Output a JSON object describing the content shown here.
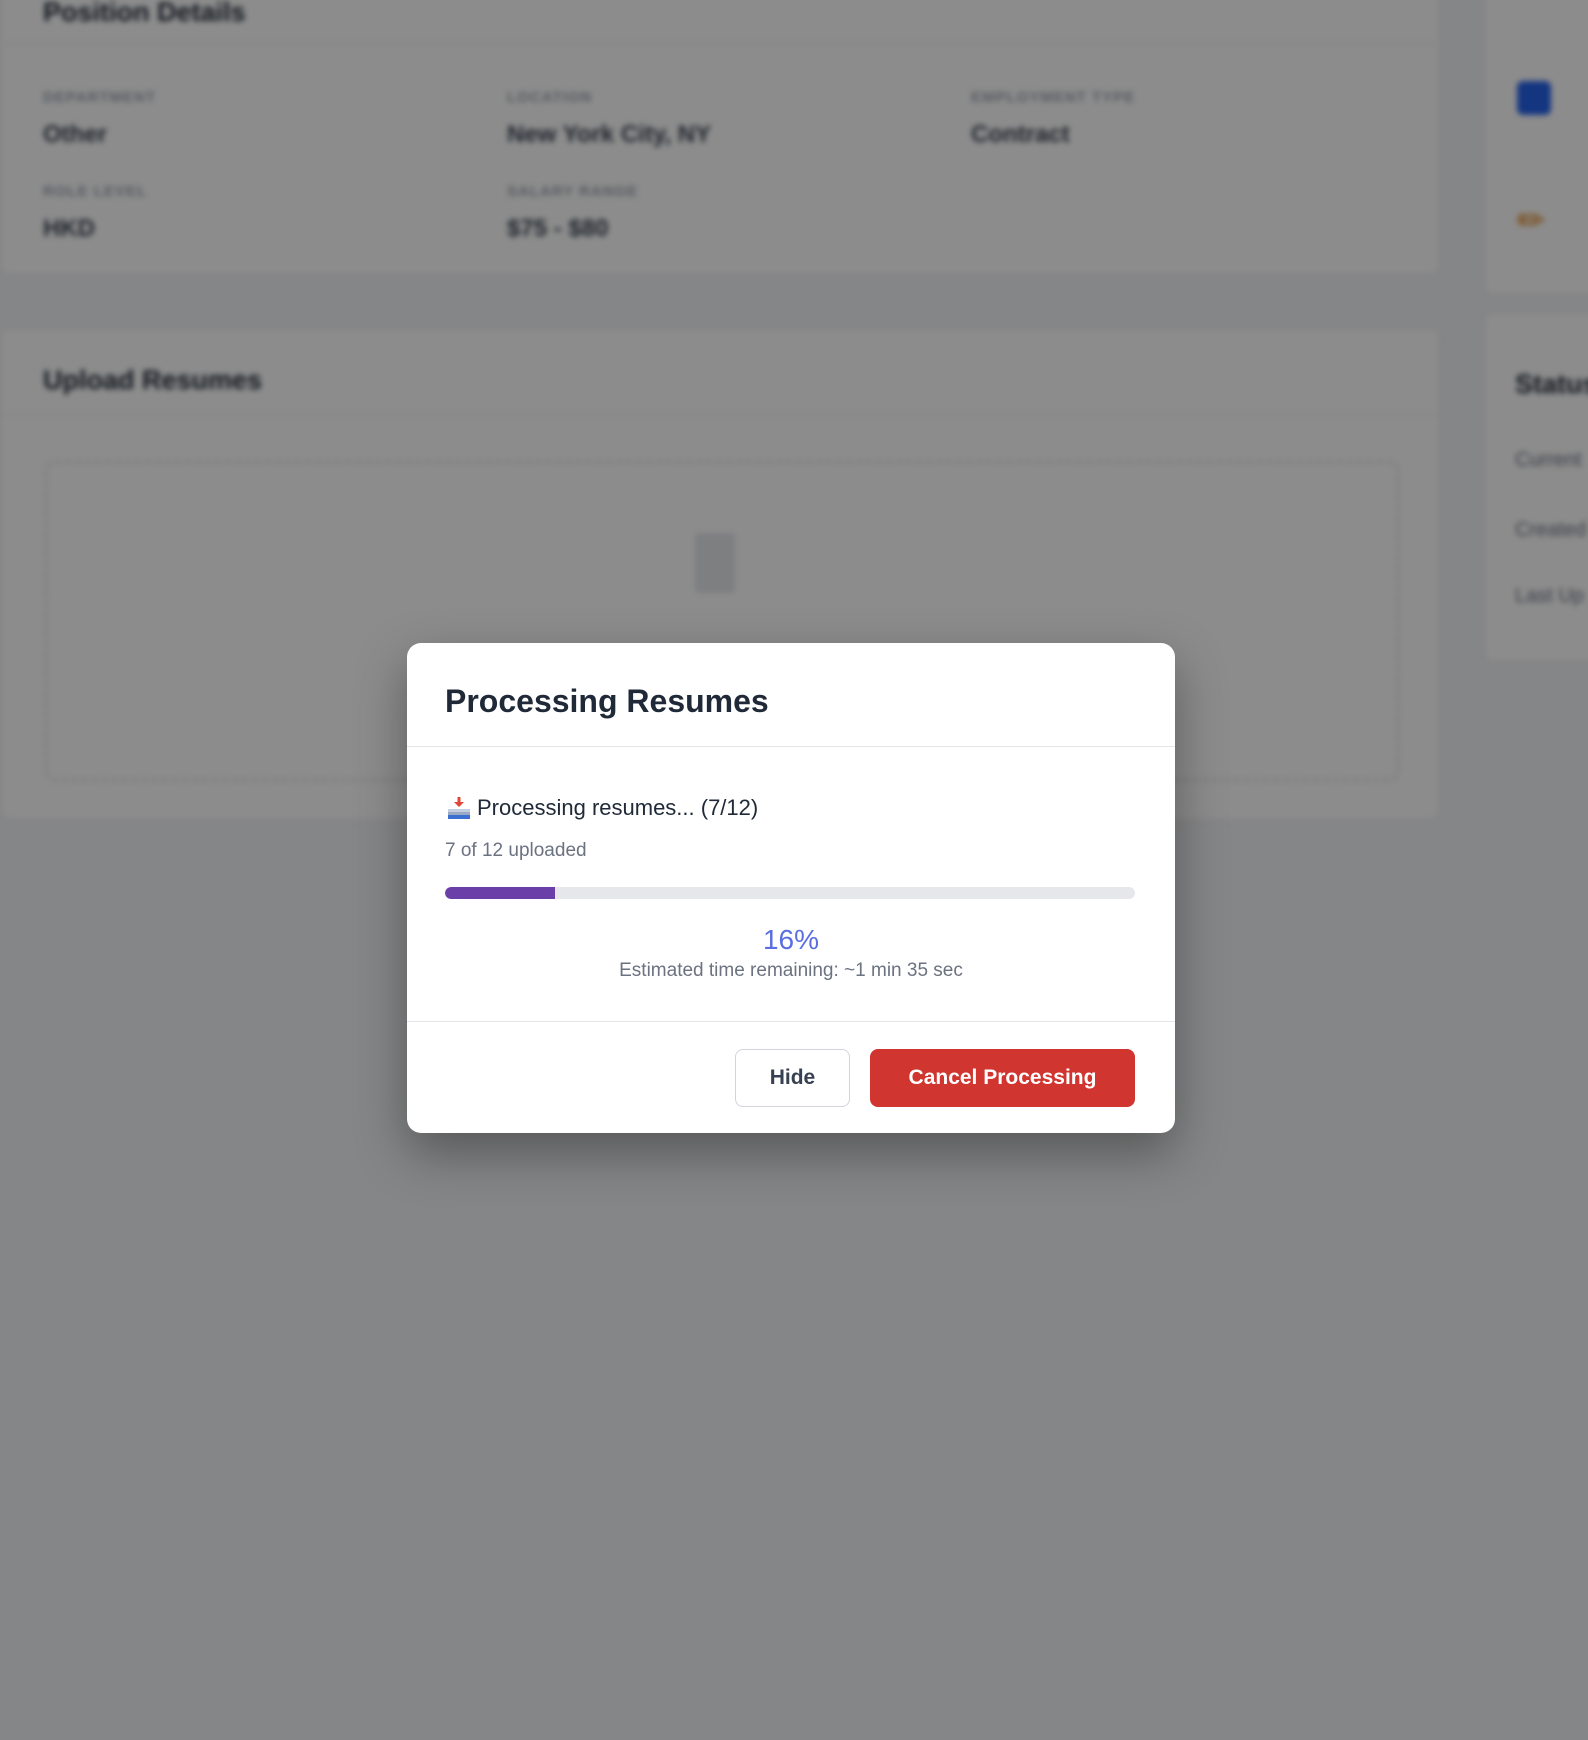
{
  "background": {
    "position_card": {
      "title": "Position Details",
      "fields": [
        {
          "label": "Department",
          "value": "Other"
        },
        {
          "label": "Location",
          "value": "New York City, NY"
        },
        {
          "label": "Employment Type",
          "value": "Contract"
        },
        {
          "label": "Role Level",
          "value": "HKD"
        },
        {
          "label": "Salary Range",
          "value": "$75 - $80"
        }
      ]
    },
    "upload_card": {
      "title": "Upload Resumes"
    },
    "status_card": {
      "title": "Status",
      "lines": [
        "Current",
        "Created",
        "Last Up"
      ]
    }
  },
  "modal": {
    "title": "Processing Resumes",
    "status_text": "Processing resumes... (7/12)",
    "uploaded_text": "7 of 12 uploaded",
    "progress_percent": 16,
    "percent_label": "16%",
    "eta_text": "Estimated time remaining: ~1 min 35 sec",
    "hide_label": "Hide",
    "cancel_label": "Cancel Processing",
    "icon": "inbox-tray-icon",
    "colors": {
      "progress_fill": "#6b3fa8",
      "percent_text": "#5b6ee1",
      "cancel_button": "#d0352f"
    }
  }
}
